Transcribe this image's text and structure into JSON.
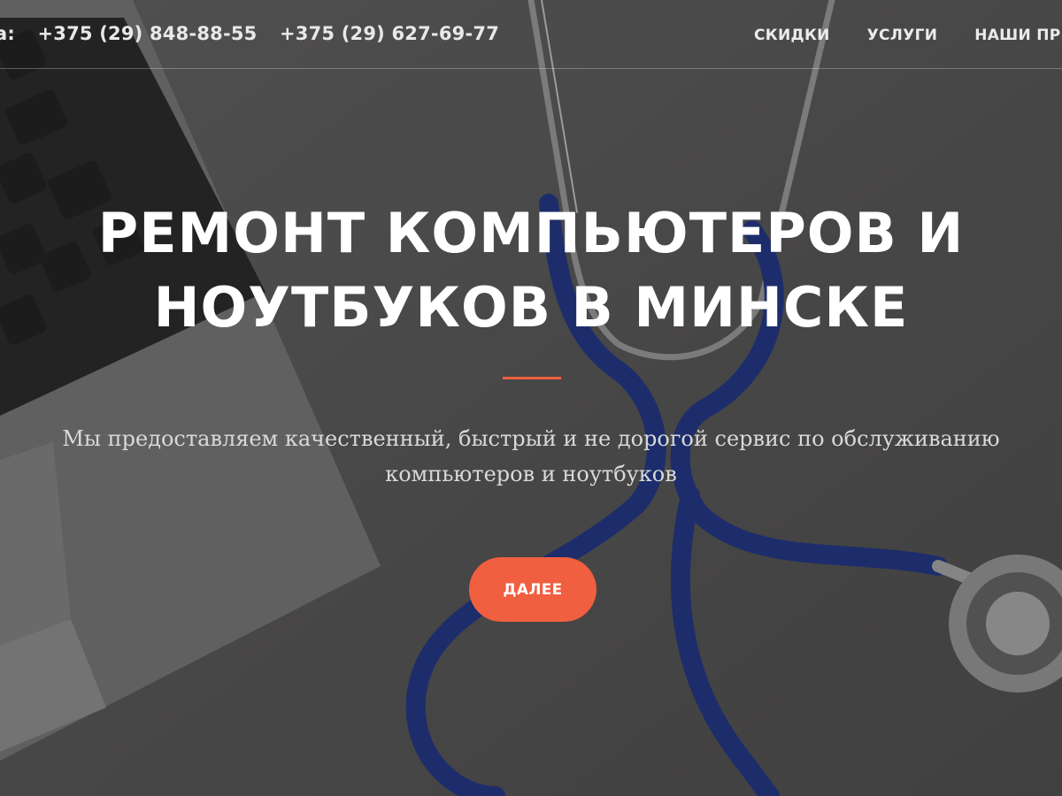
{
  "header": {
    "phone_prefix": "а:",
    "phones": [
      "+375 (29) 848-88-55",
      "+375 (29) 627-69-77"
    ]
  },
  "nav": {
    "items": [
      "СКИДКИ",
      "УСЛУГИ",
      "НАШИ ПРИЕМ"
    ]
  },
  "hero": {
    "title_line1": "РЕМОНТ КОМПЬЮТЕРОВ И",
    "title_line2": "НОУТБУКОВ В МИНСКЕ",
    "subtitle_line1": "Мы предоставляем качественный, быстрый и не дорогой сервис по обслуживанию",
    "subtitle_line2": "компьютеров и ноутбуков",
    "cta_label": "ДАЛЕЕ"
  },
  "colors": {
    "accent": "#f05f40",
    "text": "#ffffff",
    "background": "#4f4e4e",
    "stethoscope": "#1c2f7a"
  },
  "icons": [
    "laptop-keyboard-image",
    "stethoscope-image"
  ]
}
